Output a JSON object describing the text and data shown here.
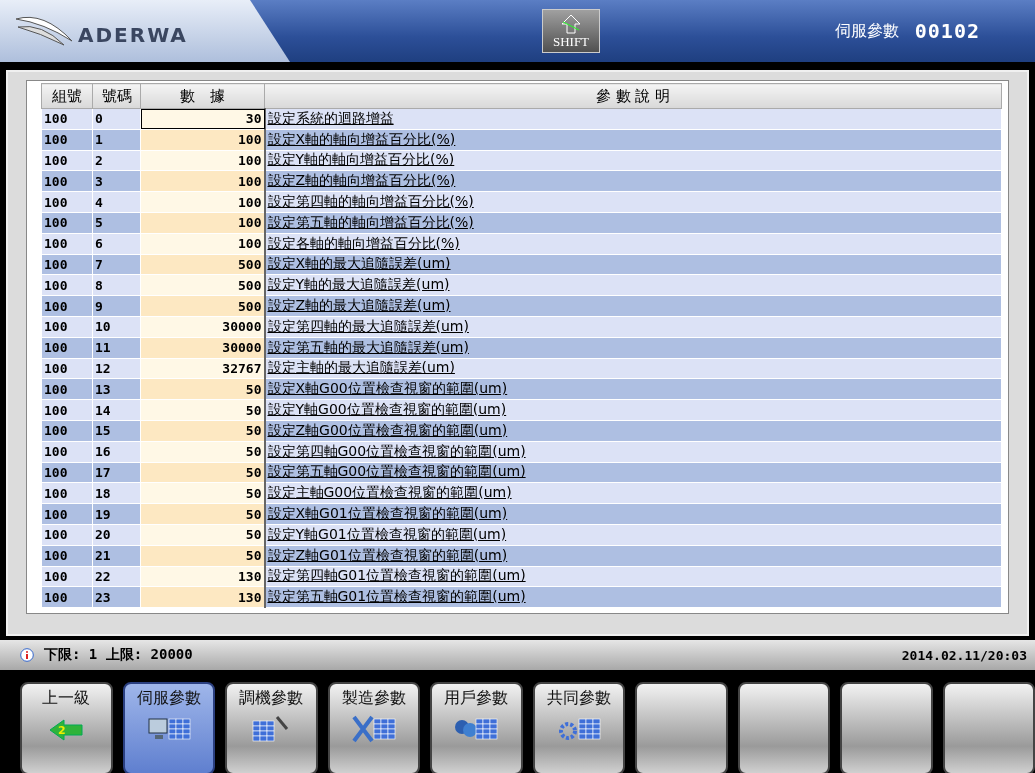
{
  "header": {
    "logo_text": "ADERWA",
    "shift_label": "SHIFT",
    "title": "伺服參數",
    "code": "00102"
  },
  "table": {
    "columns": [
      "組號",
      "號碼",
      "數　據",
      "參 數 說 明"
    ],
    "rows": [
      {
        "group": "100",
        "number": "0",
        "value": "30",
        "description": "設定系統的迴路增益",
        "selected": true
      },
      {
        "group": "100",
        "number": "1",
        "value": "100",
        "description": "設定X軸的軸向增益百分比(%)",
        "selected": false
      },
      {
        "group": "100",
        "number": "2",
        "value": "100",
        "description": "設定Y軸的軸向增益百分比(%)",
        "selected": false
      },
      {
        "group": "100",
        "number": "3",
        "value": "100",
        "description": "設定Z軸的軸向增益百分比(%)",
        "selected": false
      },
      {
        "group": "100",
        "number": "4",
        "value": "100",
        "description": "設定第四軸的軸向增益百分比(%)",
        "selected": false
      },
      {
        "group": "100",
        "number": "5",
        "value": "100",
        "description": "設定第五軸的軸向增益百分比(%)",
        "selected": false
      },
      {
        "group": "100",
        "number": "6",
        "value": "100",
        "description": "設定各軸的軸向增益百分比(%)",
        "selected": false
      },
      {
        "group": "100",
        "number": "7",
        "value": "500",
        "description": "設定X軸的最大追隨誤差(um)",
        "selected": false
      },
      {
        "group": "100",
        "number": "8",
        "value": "500",
        "description": "設定Y軸的最大追隨誤差(um)",
        "selected": false
      },
      {
        "group": "100",
        "number": "9",
        "value": "500",
        "description": "設定Z軸的最大追隨誤差(um)",
        "selected": false
      },
      {
        "group": "100",
        "number": "10",
        "value": "30000",
        "description": "設定第四軸的最大追隨誤差(um)",
        "selected": false
      },
      {
        "group": "100",
        "number": "11",
        "value": "30000",
        "description": "設定第五軸的最大追隨誤差(um)",
        "selected": false
      },
      {
        "group": "100",
        "number": "12",
        "value": "32767",
        "description": "設定主軸的最大追隨誤差(um)",
        "selected": false
      },
      {
        "group": "100",
        "number": "13",
        "value": "50",
        "description": "設定X軸G00位置檢查視窗的範圍(um)",
        "selected": false
      },
      {
        "group": "100",
        "number": "14",
        "value": "50",
        "description": "設定Y軸G00位置檢查視窗的範圍(um)",
        "selected": false
      },
      {
        "group": "100",
        "number": "15",
        "value": "50",
        "description": "設定Z軸G00位置檢查視窗的範圍(um)",
        "selected": false
      },
      {
        "group": "100",
        "number": "16",
        "value": "50",
        "description": "設定第四軸G00位置檢查視窗的範圍(um)",
        "selected": false
      },
      {
        "group": "100",
        "number": "17",
        "value": "50",
        "description": "設定第五軸G00位置檢查視窗的範圍(um)",
        "selected": false
      },
      {
        "group": "100",
        "number": "18",
        "value": "50",
        "description": "設定主軸G00位置檢查視窗的範圍(um)",
        "selected": false
      },
      {
        "group": "100",
        "number": "19",
        "value": "50",
        "description": "設定X軸G01位置檢查視窗的範圍(um)",
        "selected": false
      },
      {
        "group": "100",
        "number": "20",
        "value": "50",
        "description": "設定Y軸G01位置檢查視窗的範圍(um)",
        "selected": false
      },
      {
        "group": "100",
        "number": "21",
        "value": "50",
        "description": "設定Z軸G01位置檢查視窗的範圍(um)",
        "selected": false
      },
      {
        "group": "100",
        "number": "22",
        "value": "130",
        "description": "設定第四軸G01位置檢查視窗的範圍(um)",
        "selected": false
      },
      {
        "group": "100",
        "number": "23",
        "value": "130",
        "description": "設定第五軸G01位置檢查視窗的範圍(um)",
        "selected": false
      }
    ]
  },
  "status_bar": {
    "message": "下限: 1 上限: 20000",
    "datetime": "2014.02.11/20:03"
  },
  "softkeys": [
    {
      "label": "上一級",
      "kind": "back",
      "badge": "2",
      "selected": false
    },
    {
      "label": "伺服參數",
      "kind": "servo",
      "selected": true
    },
    {
      "label": "調機參數",
      "kind": "tuning",
      "selected": false
    },
    {
      "label": "製造參數",
      "kind": "manufacture",
      "selected": false
    },
    {
      "label": "用戶參數",
      "kind": "user",
      "selected": false
    },
    {
      "label": "共同參數",
      "kind": "common",
      "selected": false
    },
    {
      "kind": "empty",
      "selected": false
    },
    {
      "kind": "empty",
      "selected": false
    },
    {
      "kind": "empty",
      "selected": false
    },
    {
      "kind": "empty",
      "selected": false
    }
  ]
}
